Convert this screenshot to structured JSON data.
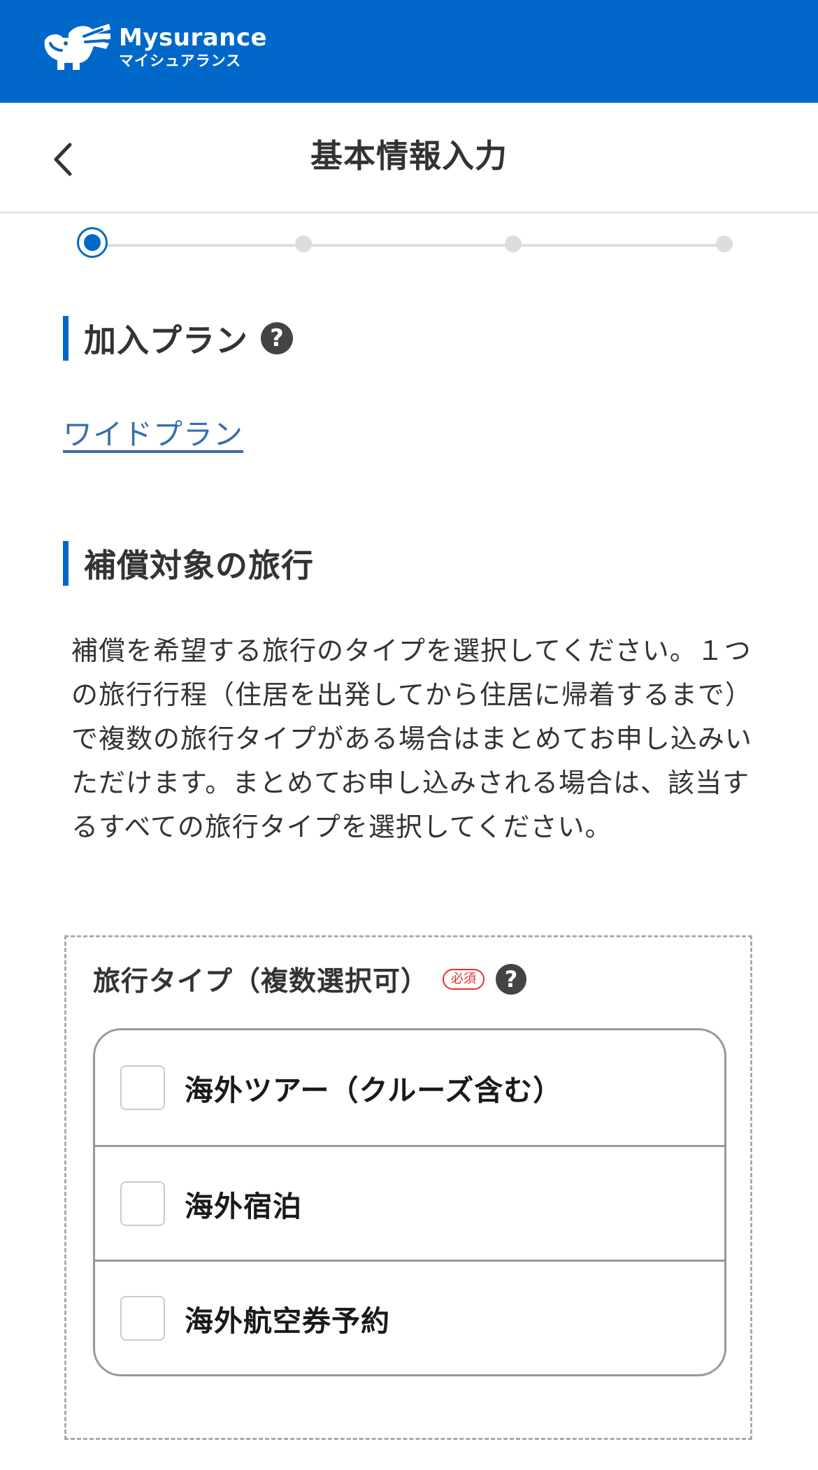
{
  "brand": {
    "name_en": "Mysurance",
    "name_ja": "マイシュアランス",
    "color": "#0068c8"
  },
  "header": {
    "title": "基本情報入力",
    "back_icon": "chevron-left-icon"
  },
  "stepper": {
    "total_steps": 4,
    "current_step": 1
  },
  "plan_section": {
    "heading": "加入プラン",
    "help_icon": "?",
    "plan_link": "ワイドプラン"
  },
  "travel_section": {
    "heading": "補償対象の旅行",
    "description": "補償を希望する旅行のタイプを選択してください。１つの旅行行程（住居を出発してから住居に帰着するまで）で複数の旅行タイプがある場合はまとめてお申し込みいただけます。まとめてお申し込みされる場合は、該当するすべての旅行タイプを選択してください。"
  },
  "travel_type": {
    "label": "旅行タイプ（複数選択可）",
    "required_badge": "必須",
    "help_icon": "?",
    "options": [
      {
        "label": "海外ツアー（クルーズ含む）",
        "checked": false
      },
      {
        "label": "海外宿泊",
        "checked": false
      },
      {
        "label": "海外航空券予約",
        "checked": false
      }
    ]
  }
}
